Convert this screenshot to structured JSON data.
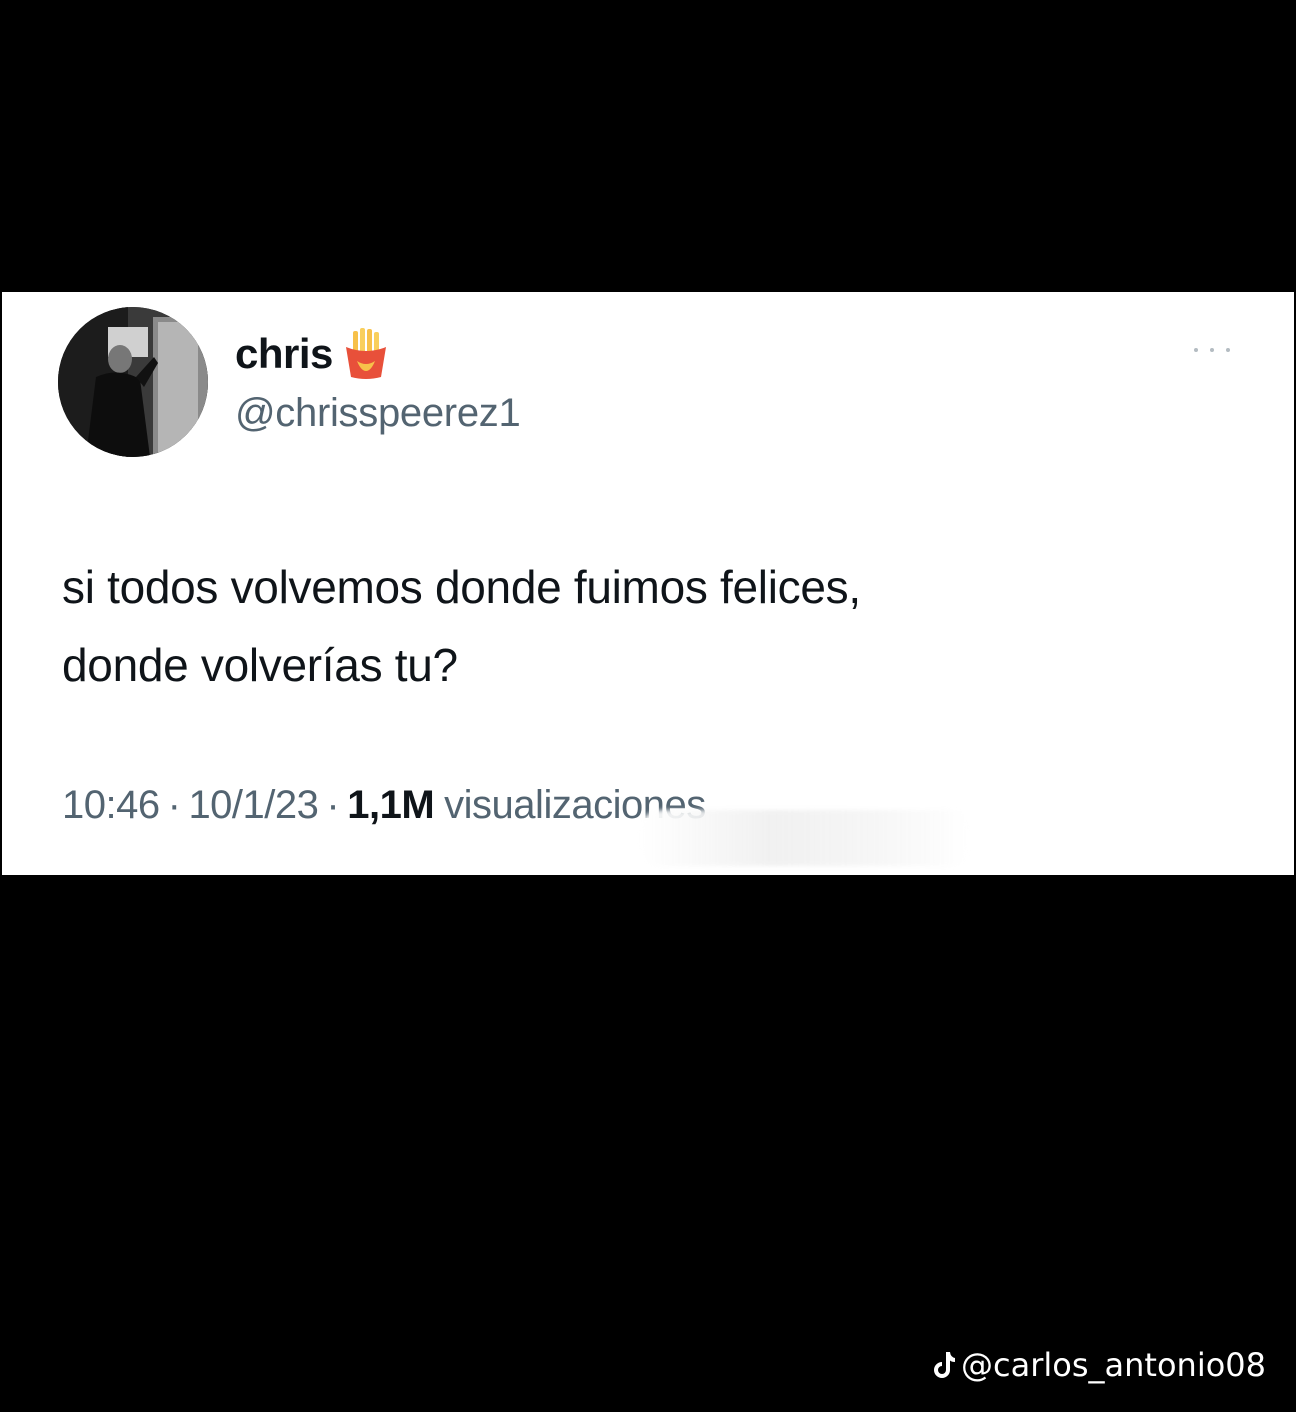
{
  "tweet": {
    "display_name": "chris",
    "badge_icon": "fries-emoji-icon",
    "handle": "@chrisspeerez1",
    "text_lines": [
      "si todos volvemos donde fuimos felices,",
      "donde volverías tu?"
    ],
    "time": "10:46",
    "date": "10/1/23",
    "separator": "·",
    "views_count": "1,1M",
    "views_label": "visualizaciones"
  },
  "tiktok": {
    "icon": "tiktok-logo-icon",
    "username": "@carlos_antonio08"
  },
  "colors": {
    "background": "#000000",
    "card": "#ffffff",
    "text_primary": "#0f1419",
    "text_secondary": "#536471",
    "badge_red": "#e8503a",
    "badge_yellow": "#f7c14a"
  }
}
